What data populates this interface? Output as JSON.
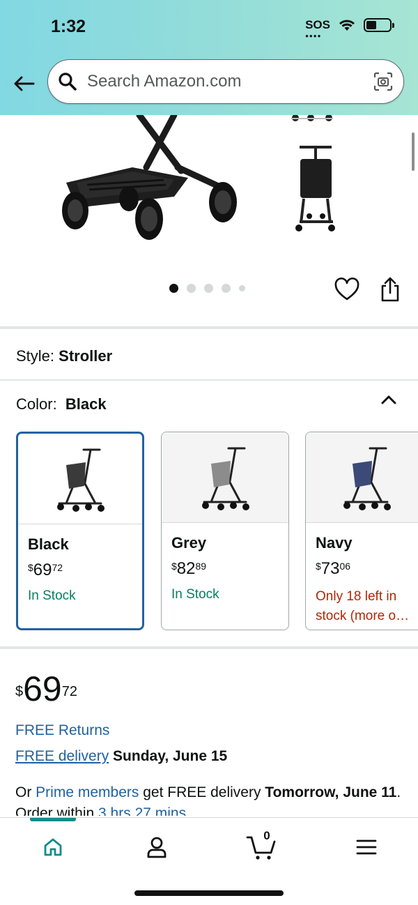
{
  "status_bar": {
    "time": "1:32",
    "sos": "SOS"
  },
  "search": {
    "placeholder": "Search Amazon.com"
  },
  "gallery": {
    "image_count": 5,
    "active_index": 0
  },
  "style": {
    "label": "Style:",
    "value": "Stroller"
  },
  "color": {
    "label": "Color:",
    "value": "Black"
  },
  "swatches": [
    {
      "name": "Black",
      "price_dollars": "69",
      "price_cents": "72",
      "stock": "In Stock",
      "seat_color": "#3a3a3a",
      "selected": true
    },
    {
      "name": "Grey",
      "price_dollars": "82",
      "price_cents": "89",
      "stock": "In Stock",
      "seat_color": "#8c8c8c",
      "selected": false
    },
    {
      "name": "Navy",
      "price_dollars": "73",
      "price_cents": "06",
      "stock_line1": "Only 18 left in",
      "stock_line2": "stock (more o…",
      "seat_color": "#3b4a78",
      "selected": false
    }
  ],
  "price": {
    "currency": "$",
    "dollars": "69",
    "cents": "72"
  },
  "returns": {
    "text": "FREE Returns"
  },
  "delivery": {
    "link": "FREE delivery",
    "date": "Sunday, June 15"
  },
  "prime": {
    "prefix": "Or",
    "link": "Prime members",
    "middle": "get FREE delivery",
    "bold": "Tomorrow,",
    "bold2": "June 11",
    "suffix": ". Order within",
    "countdown": "3 hrs 27 mins"
  },
  "bottom_nav": {
    "cart_count": "0"
  },
  "colors": {
    "link": "#2162a1",
    "in_stock": "#067d62",
    "low_stock": "#b12704",
    "selected_border": "#2162a1",
    "nav_accent": "#168a8a"
  }
}
